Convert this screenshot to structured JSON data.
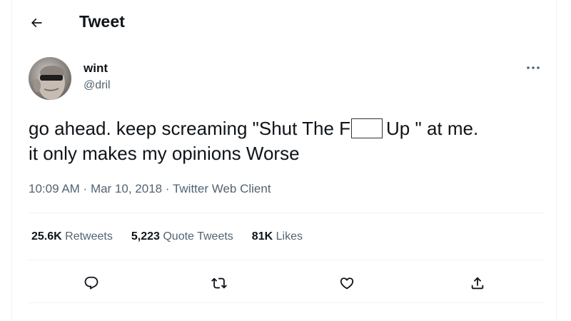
{
  "header": {
    "title": "Tweet",
    "back_icon": "arrow-left-icon"
  },
  "tweet": {
    "author": {
      "display_name": "wint",
      "handle": "@dril"
    },
    "more_icon": "more-horizontal-icon",
    "text": {
      "line1_before": "go ahead. keep screaming \"Shut The F",
      "line1_after": "Up \" at me.",
      "line2": "it only makes my opinions Worse"
    },
    "meta": {
      "time": "10:09 AM",
      "separator": " · ",
      "date": "Mar 10, 2018",
      "source": "Twitter Web Client"
    },
    "stats": [
      {
        "count": "25.6K",
        "label": "Retweets"
      },
      {
        "count": "5,223",
        "label": "Quote Tweets"
      },
      {
        "count": "81K",
        "label": "Likes"
      }
    ],
    "actions": [
      {
        "name": "reply",
        "icon": "reply-icon"
      },
      {
        "name": "retweet",
        "icon": "retweet-icon"
      },
      {
        "name": "like",
        "icon": "heart-icon"
      },
      {
        "name": "share",
        "icon": "share-icon"
      }
    ]
  },
  "colors": {
    "text": "#0f1419",
    "secondary": "#536471",
    "border": "#eff3f4"
  }
}
